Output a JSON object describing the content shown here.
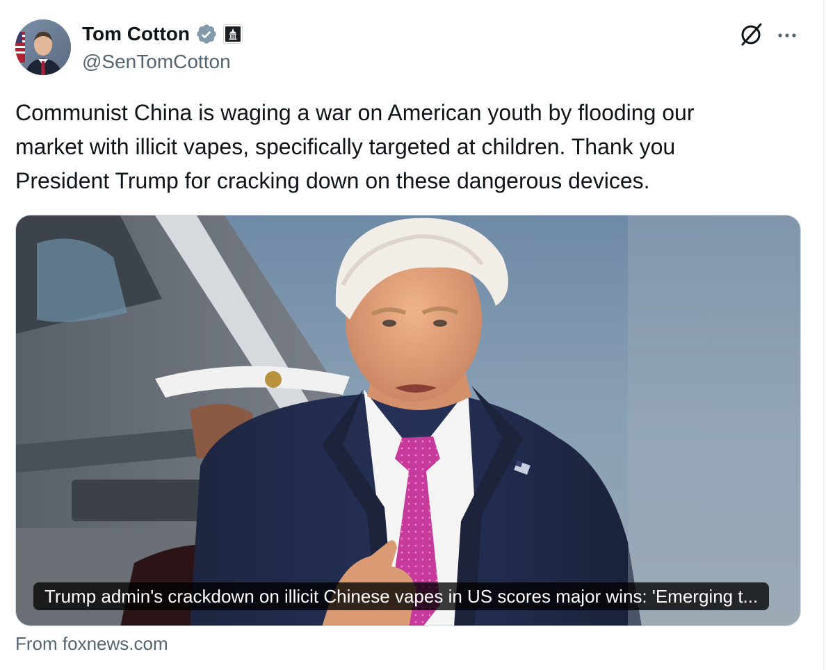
{
  "author": {
    "display_name": "Tom Cotton",
    "handle": "@SenTomCotton",
    "verified_icon": "verified-badge-icon",
    "affiliation_icon": "government-building-icon"
  },
  "header_actions": {
    "grok_icon": "grok-slash-circle-icon",
    "more_icon": "more-horizontal-icon"
  },
  "tweet": {
    "text": "Communist China is waging a war on American youth by flooding our\nmarket with illicit vapes, specifically targeted at children. Thank you\nPresident Trump for cracking down on these dangerous devices."
  },
  "link_card": {
    "headline": "Trump admin's crackdown on illicit Chinese vapes in US scores major wins: 'Emerging t...",
    "source": "From foxnews.com"
  },
  "colors": {
    "text_primary": "#0f1419",
    "text_secondary": "#536471",
    "border": "#cfd9de",
    "verified_gray": "#829aab"
  }
}
